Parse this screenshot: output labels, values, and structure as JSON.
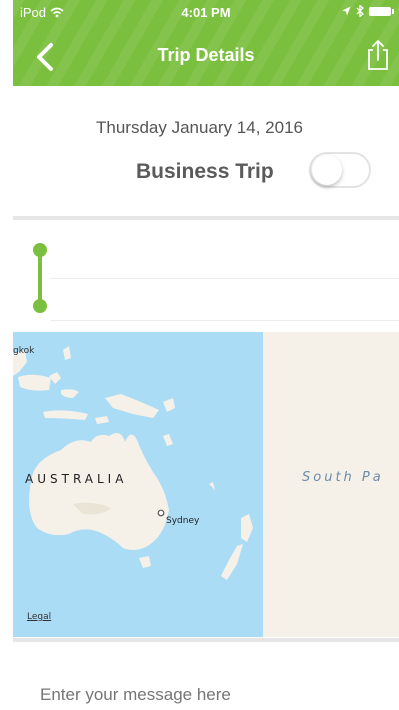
{
  "status_bar": {
    "carrier": "iPod",
    "time": "4:01 PM"
  },
  "nav": {
    "title": "Trip Details",
    "back_icon": "chevron-left-icon",
    "share_icon": "share-icon",
    "color": "#7bbf3f"
  },
  "trip": {
    "date": "Thursday January 14, 2016",
    "business_trip_label": "Business Trip",
    "business_trip_enabled": false
  },
  "map": {
    "labels": {
      "bangkok": "gkok",
      "australia": "AUSTRALIA",
      "sydney": "Sydney",
      "ocean": "South Pa",
      "legal": "Legal"
    },
    "land_color": "#f5f1e9",
    "water_color": "#abdcf6"
  },
  "message": {
    "placeholder": "Enter your message here"
  }
}
